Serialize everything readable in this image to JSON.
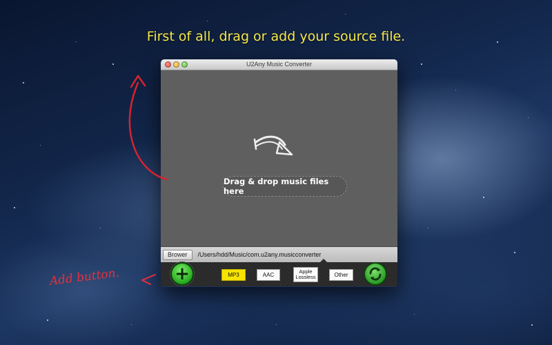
{
  "headline": "First of all, drag or add your source file.",
  "window": {
    "title": "U2Any Music Converter"
  },
  "dropzone": {
    "label": "Drag & drop music files here"
  },
  "pathbar": {
    "browse_label": "Brower",
    "path": "/Users/hdd/Music/com.u2any.musicconverter"
  },
  "formats": [
    {
      "label": "MP3",
      "active": true
    },
    {
      "label": "AAC",
      "active": false
    },
    {
      "label_line1": "Apple",
      "label_line2": "Lossless",
      "active": false
    },
    {
      "label": "Other",
      "active": false
    }
  ],
  "annotation": {
    "label": "Add button."
  },
  "colors": {
    "headline": "#f5e84a",
    "annotation": "#e8303b",
    "active_format": "#f7e300",
    "button_green": "#24a81e"
  },
  "icons": {
    "add": "plus-icon",
    "convert": "refresh-icon",
    "drop": "curved-arrow-icon"
  }
}
